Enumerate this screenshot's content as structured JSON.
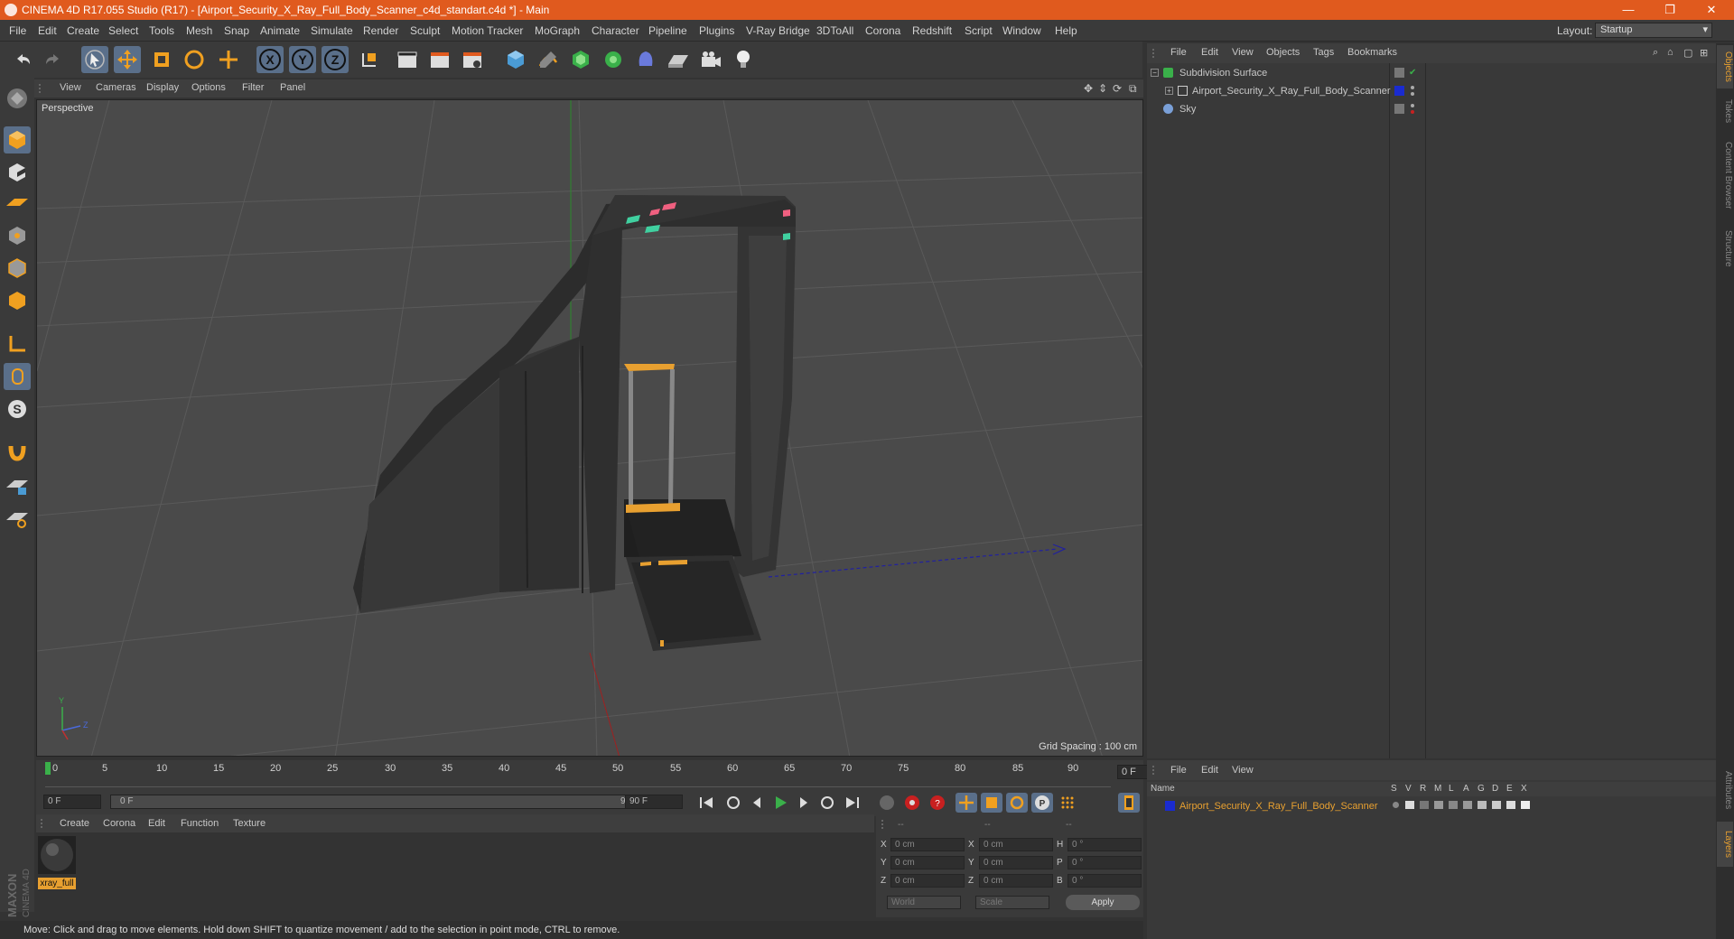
{
  "window": {
    "title": "CINEMA 4D R17.055 Studio (R17) - [Airport_Security_X_Ray_Full_Body_Scanner_c4d_standart.c4d *] - Main",
    "controls": {
      "minimize": "—",
      "restore": "❐",
      "close": "✕"
    }
  },
  "menu": [
    "File",
    "Edit",
    "Create",
    "Select",
    "Tools",
    "Mesh",
    "Snap",
    "Animate",
    "Simulate",
    "Render",
    "Sculpt",
    "Motion Tracker",
    "MoGraph",
    "Character",
    "Pipeline",
    "Plugins",
    "V-Ray Bridge",
    "3DToAll",
    "Corona",
    "Redshift",
    "Script",
    "Window",
    "Help"
  ],
  "layout": {
    "label": "Layout:",
    "value": "Startup"
  },
  "viewport": {
    "menu": [
      "View",
      "Cameras",
      "Display",
      "Options",
      "Filter",
      "Panel"
    ],
    "label": "Perspective",
    "grid_spacing": "Grid Spacing : 100 cm"
  },
  "timeline": {
    "ticks": [
      "0",
      "5",
      "10",
      "15",
      "20",
      "25",
      "30",
      "35",
      "40",
      "45",
      "50",
      "55",
      "60",
      "65",
      "70",
      "75",
      "80",
      "85",
      "90"
    ],
    "current_frame": "0 F"
  },
  "transport": {
    "start": "0 F",
    "range_start": "0 F",
    "range_end": "90 F",
    "end": "90 F"
  },
  "material_manager": {
    "menu": [
      "Create",
      "Corona",
      "Edit",
      "Function",
      "Texture"
    ],
    "materials": [
      {
        "name": "xray_full"
      }
    ]
  },
  "coordinates": {
    "headers": [
      "--",
      "--",
      "--"
    ],
    "rows": [
      {
        "a": "X",
        "av": "0 cm",
        "b": "X",
        "bv": "0 cm",
        "c": "H",
        "cv": "0 °"
      },
      {
        "a": "Y",
        "av": "0 cm",
        "b": "Y",
        "bv": "0 cm",
        "c": "P",
        "cv": "0 °"
      },
      {
        "a": "Z",
        "av": "0 cm",
        "b": "Z",
        "bv": "0 cm",
        "c": "B",
        "cv": "0 °"
      }
    ],
    "mode": "World",
    "transform": "Scale",
    "apply": "Apply"
  },
  "object_manager": {
    "menu": [
      "File",
      "Edit",
      "View",
      "Objects",
      "Tags",
      "Bookmarks"
    ],
    "objects": [
      {
        "name": "Subdivision Surface"
      },
      {
        "name": "Airport_Security_X_Ray_Full_Body_Scanner",
        "color": "#1a2bd0"
      },
      {
        "name": "Sky"
      }
    ]
  },
  "layer_manager": {
    "menu": [
      "File",
      "Edit",
      "View"
    ],
    "columns": [
      "Name",
      "S",
      "V",
      "R",
      "M",
      "L",
      "A",
      "G",
      "D",
      "E",
      "X"
    ],
    "layers": [
      {
        "name": "Airport_Security_X_Ray_Full_Body_Scanner",
        "color": "#1a2bd0"
      }
    ]
  },
  "right_tabs": [
    "Objects",
    "Takes",
    "Content Browser",
    "Structure",
    "Attributes",
    "Layers"
  ],
  "status": "Move: Click and drag to move elements. Hold down SHIFT to quantize movement / add to the selection in point mode, CTRL to remove.",
  "brand": "MAXON CINEMA 4D",
  "colors": {
    "titlebar": "#e05a1e",
    "selection": "#5a6f8a",
    "highlight": "#e8a030"
  }
}
